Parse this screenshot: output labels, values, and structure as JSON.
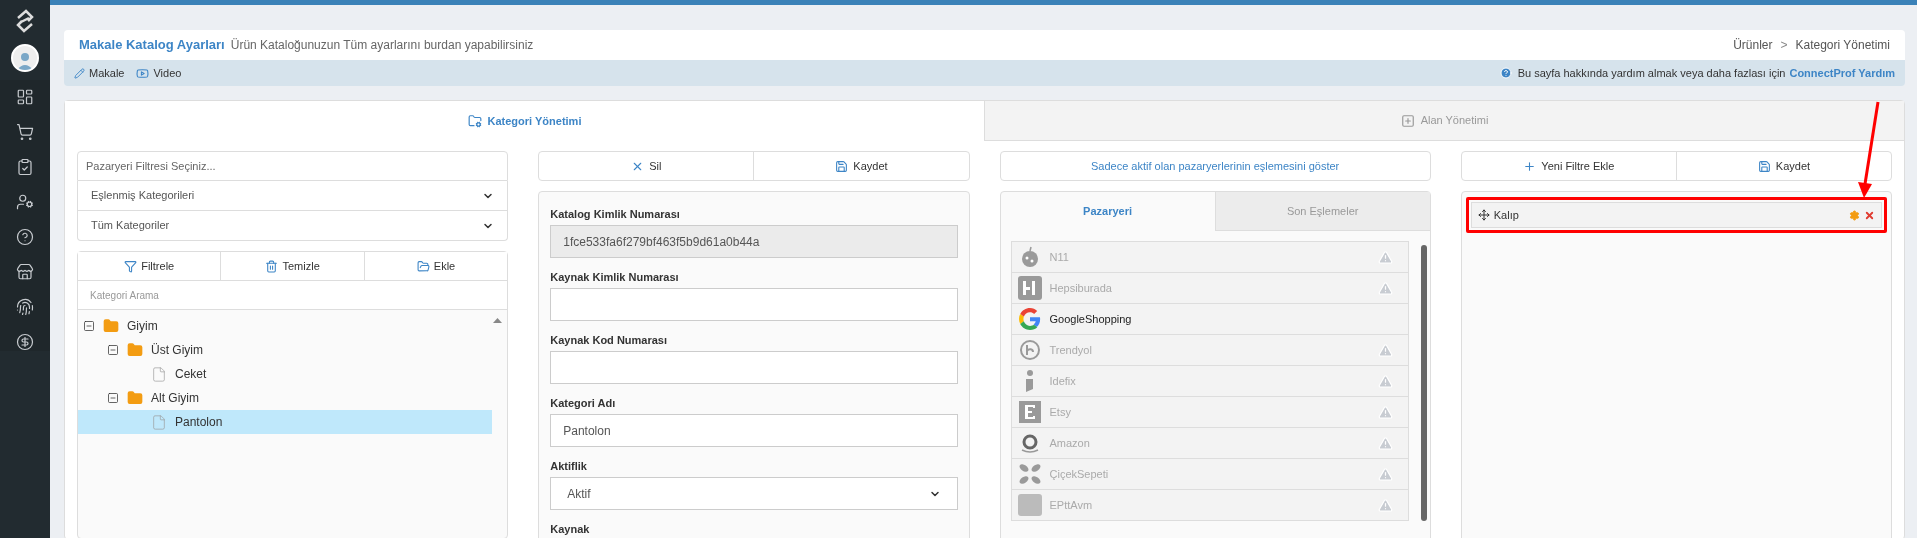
{
  "header": {
    "title": "Makale Katalog Ayarları",
    "subtitle": "Ürün Kataloğunuzun Tüm ayarlarını burdan yapabilirsiniz",
    "breadcrumb": [
      "Ürünler",
      "Kategori Yönetimi"
    ],
    "separator": ">"
  },
  "help_bar": {
    "links": [
      {
        "label": "Makale",
        "kind": "article"
      },
      {
        "label": "Video",
        "kind": "video"
      }
    ],
    "help_text": "Bu sayfa hakkında yardım almak veya daha fazlası için",
    "help_link": "ConnectProf Yardım"
  },
  "main_tabs": [
    {
      "label": "Kategori Yönetimi",
      "selected": true,
      "kind": "category"
    },
    {
      "label": "Alan Yönetimi",
      "selected": false,
      "kind": "field"
    }
  ],
  "category_filters": {
    "placeholder": "Pazaryeri Filtresi Seçiniz...",
    "selects": [
      "Eşlenmiş Kategorileri",
      "Tüm Kategoriler"
    ]
  },
  "tree_toolbar": [
    {
      "label": "Filtrele",
      "kind": "filter"
    },
    {
      "label": "Temizle",
      "kind": "clear"
    },
    {
      "label": "Ekle",
      "kind": "add"
    }
  ],
  "tree_search": {
    "placeholder": "Kategori Arama"
  },
  "tree": [
    {
      "label": "Giyim",
      "kind": "folder",
      "expanded": true,
      "selected": false,
      "children": [
        {
          "label": "Üst Giyim",
          "kind": "folder",
          "expanded": true,
          "selected": false,
          "children": [
            {
              "label": "Ceket",
              "kind": "file",
              "selected": false
            }
          ]
        },
        {
          "label": "Alt Giyim",
          "kind": "folder",
          "expanded": true,
          "selected": false,
          "children": [
            {
              "label": "Pantolon",
              "kind": "file",
              "selected": true
            }
          ]
        }
      ]
    }
  ],
  "form_actions": [
    {
      "label": "Sil",
      "kind": "delete"
    },
    {
      "label": "Kaydet",
      "kind": "save"
    }
  ],
  "form_fields": [
    {
      "label": "Katalog Kimlik Numarası",
      "kind": "input",
      "value": "1fce533fa6f279bf463f5b9d61a0b44a",
      "disabled": true
    },
    {
      "label": "Kaynak Kimlik Numarası",
      "kind": "input",
      "disabled": false
    },
    {
      "label": "Kaynak Kod Numarası",
      "kind": "input",
      "disabled": false
    },
    {
      "label": "Kategori Adı",
      "kind": "input",
      "value": "Pantolon",
      "disabled": false
    },
    {
      "label": "Aktiflik",
      "kind": "select",
      "value": "Aktif",
      "disabled": false
    },
    {
      "label": "Kaynak",
      "kind": "label"
    }
  ],
  "marketplace_toggle": "Sadece aktif olan pazaryerlerinin eşlemesini göster",
  "marketplace_tabs": [
    {
      "label": "Pazaryeri",
      "selected": true
    },
    {
      "label": "Son Eşlemeler",
      "selected": false
    }
  ],
  "marketplaces": [
    {
      "name": "N11",
      "active": false,
      "warning": true
    },
    {
      "name": "Hepsiburada",
      "active": false,
      "warning": true
    },
    {
      "name": "GoogleShopping",
      "active": true,
      "warning": false
    },
    {
      "name": "Trendyol",
      "active": false,
      "warning": true
    },
    {
      "name": "Idefix",
      "active": false,
      "warning": true
    },
    {
      "name": "Etsy",
      "active": false,
      "warning": true
    },
    {
      "name": "Amazon",
      "active": false,
      "warning": true
    },
    {
      "name": "ÇiçekSepeti",
      "active": false,
      "warning": true
    },
    {
      "name": "EPttAvm",
      "active": false,
      "warning": true
    }
  ],
  "filter_actions": [
    {
      "label": "Yeni Filtre Ekle",
      "kind": "add"
    },
    {
      "label": "Kaydet",
      "kind": "save"
    }
  ],
  "filters": [
    {
      "label": "Kalıp",
      "highlighted": true
    }
  ]
}
